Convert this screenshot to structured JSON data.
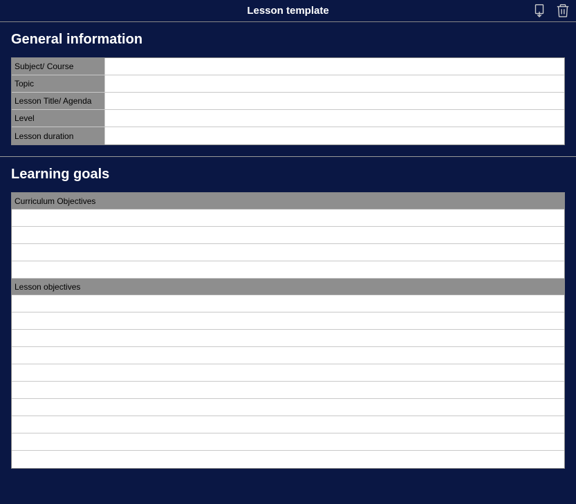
{
  "header": {
    "title": "Lesson template"
  },
  "sections": {
    "general": {
      "title": "General information",
      "rows": {
        "subject": "Subject/ Course",
        "topic": "Topic",
        "lessonTitle": "Lesson Title/ Agenda",
        "level": "Level",
        "duration": "Lesson duration"
      }
    },
    "goals": {
      "title": "Learning goals",
      "curriculum": "Curriculum Objectives",
      "lessonObjectives": "Lesson objectives"
    }
  }
}
